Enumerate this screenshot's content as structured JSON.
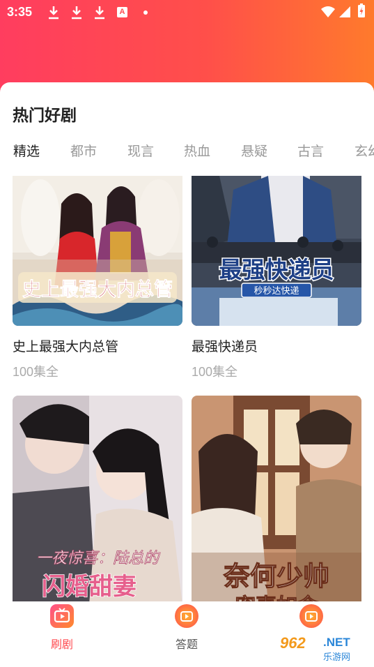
{
  "status_bar": {
    "time": "3:35",
    "a_badge": "A"
  },
  "section": {
    "title": "热门好剧"
  },
  "tabs": [
    {
      "label": "精选",
      "active": true
    },
    {
      "label": "都市"
    },
    {
      "label": "现言"
    },
    {
      "label": "热血"
    },
    {
      "label": "悬疑"
    },
    {
      "label": "古言"
    },
    {
      "label": "玄幻"
    }
  ],
  "dramas": [
    {
      "title": "史上最强大内总管",
      "episodes": "100集全",
      "poster_text": "史上最强大内总管"
    },
    {
      "title": "最强快递员",
      "episodes": "100集全",
      "poster_text": "最强快递员",
      "poster_badge": "秒秒达快递"
    },
    {
      "title": "",
      "episodes": "",
      "poster_text": "一夜惊喜：陆总的",
      "poster_text2": "闪婚甜妻"
    },
    {
      "title": "",
      "episodes": "",
      "poster_text": "奈何少帅",
      "poster_text2": "宠妻如命"
    }
  ],
  "bottom_nav": [
    {
      "label": "刷剧",
      "active": true,
      "icon": "tv-play-icon"
    },
    {
      "label": "答题",
      "active": false,
      "icon": "tv-play-icon"
    },
    {
      "label": "",
      "active": false,
      "icon": "tv-play-icon"
    }
  ],
  "watermark": {
    "logo": "962",
    "net": ".NET",
    "sub": "乐游网"
  },
  "colors": {
    "accent": "#ff4a4f",
    "tab_active": "#222222",
    "tab_inactive": "#999999"
  }
}
